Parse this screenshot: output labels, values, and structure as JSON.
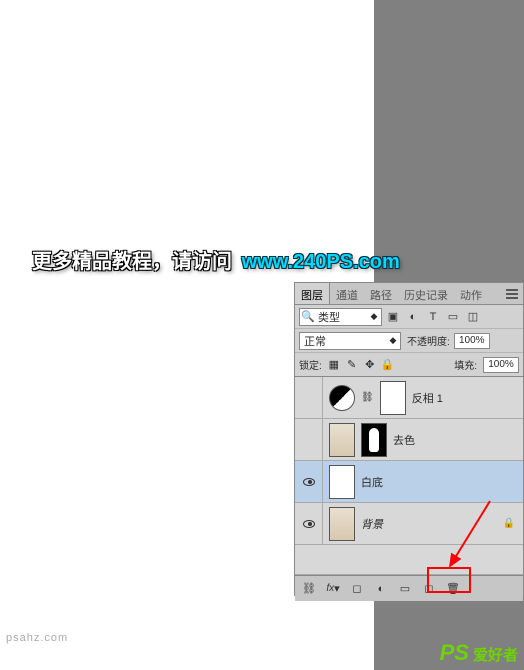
{
  "overlay": {
    "text1": "更多精品教程，请访问",
    "text2": "www.240PS.com"
  },
  "panel": {
    "tabs": [
      "图层",
      "通道",
      "路径",
      "历史记录",
      "动作"
    ],
    "active_tab": 0,
    "filter": {
      "label": "类型"
    },
    "blend": {
      "mode": "正常",
      "opacity_label": "不透明度:",
      "opacity": "100%"
    },
    "lock": {
      "label": "锁定:",
      "fill_label": "填充:",
      "fill": "100%"
    },
    "layers": [
      {
        "name": "反相 1",
        "visible": false,
        "type": "adj"
      },
      {
        "name": "去色",
        "visible": false,
        "type": "masked"
      },
      {
        "name": "白底",
        "visible": true,
        "type": "plain",
        "selected": true
      },
      {
        "name": "背景",
        "visible": true,
        "type": "bg"
      }
    ]
  },
  "watermark": {
    "site": "psahz.com",
    "logo": "PS",
    "cn": "爱好者"
  }
}
